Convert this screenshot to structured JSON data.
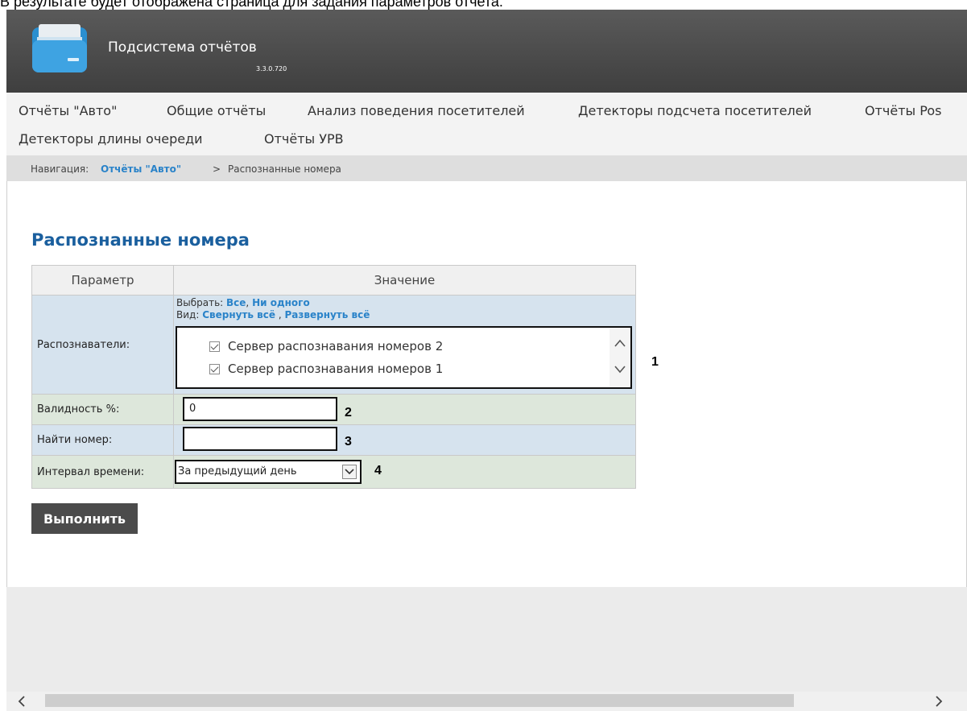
{
  "caption": "В результате будет отображена страница для задания параметров отчета.",
  "header": {
    "title": "Подсистема отчётов",
    "version": "3.3.0.720",
    "logo_icon": "folder-icon"
  },
  "nav": {
    "items": [
      "Отчёты \"Авто\"",
      "Общие отчёты",
      "Анализ поведения посетителей",
      "Детекторы подсчета посетителей",
      "Отчёты Pos",
      "Детекторы длины очереди",
      "Отчёты УРВ"
    ]
  },
  "breadcrumb": {
    "prefix": "Навигация:",
    "link": "Отчёты \"Авто\"",
    "separator": ">",
    "current": "Распознанные номера"
  },
  "page": {
    "title": "Распознанные номера"
  },
  "params": {
    "header_param": "Параметр",
    "header_value": "Значение",
    "recognizers": {
      "label": "Распознаватели:",
      "select_prefix": "Выбрать:",
      "select_all": "Все",
      "select_comma": ",",
      "select_none": "Ни одного",
      "view_prefix": "Вид:",
      "collapse_all": "Свернуть всё",
      "view_comma": ",",
      "expand_all": "Развернуть всё",
      "items": [
        {
          "label": "Сервер распознавания номеров 2",
          "checked": true
        },
        {
          "label": "Сервер распознавания номеров 1",
          "checked": true
        }
      ]
    },
    "validity": {
      "label": "Валидность %:",
      "value": "0"
    },
    "find_number": {
      "label": "Найти номер:",
      "value": ""
    },
    "interval": {
      "label": "Интервал времени:",
      "selected": "За предыдущий день"
    }
  },
  "callouts": [
    "1",
    "2",
    "3",
    "4"
  ],
  "run_button": "Выполнить",
  "colors": {
    "header": "#4a4a4a",
    "link": "#2a83c9",
    "title": "#1a5f9e",
    "row_blue": "#d6e3ee",
    "row_green": "#dde7db"
  }
}
